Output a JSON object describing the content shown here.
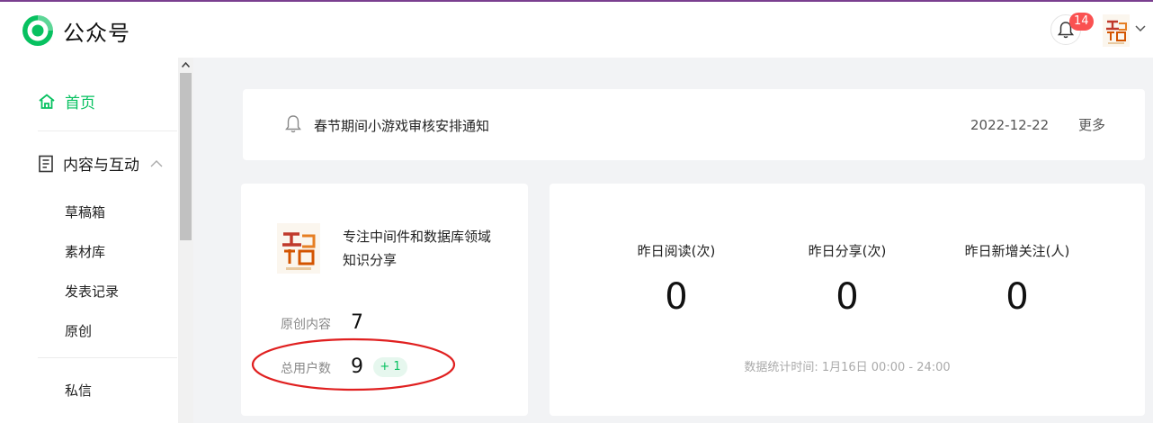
{
  "header": {
    "app_title": "公众号",
    "notification_count": "14"
  },
  "sidebar": {
    "home": "首页",
    "content_group": "内容与互动",
    "sub_items": [
      "草稿箱",
      "素材库",
      "发表记录",
      "原创"
    ],
    "messages": "私信"
  },
  "notice": {
    "text": "春节期间小游戏审核安排通知",
    "date": "2022-12-22",
    "more": "更多"
  },
  "profile": {
    "description": "专注中间件和数据库领域知识分享",
    "original_label": "原创内容",
    "original_value": "7",
    "users_label": "总用户数",
    "users_value": "9",
    "users_delta": "+ 1"
  },
  "stats": {
    "items": [
      {
        "title": "昨日阅读(次)",
        "value": "0"
      },
      {
        "title": "昨日分享(次)",
        "value": "0"
      },
      {
        "title": "昨日新增关注(人)",
        "value": "0"
      }
    ],
    "time_note": "数据统计时间: 1月16日 00:00 - 24:00"
  },
  "colors": {
    "accent": "#07c160",
    "badge": "#fa5151",
    "annotation": "#e02020"
  }
}
